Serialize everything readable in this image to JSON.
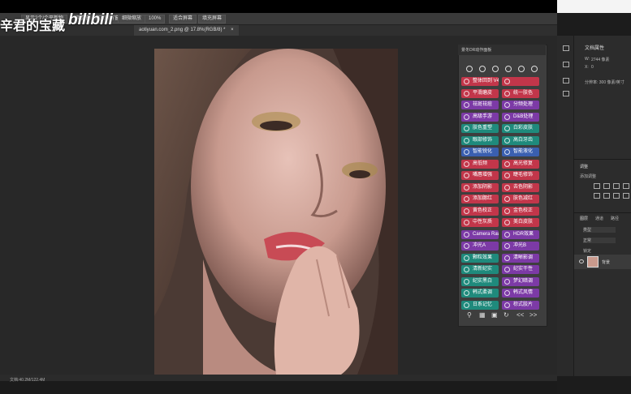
{
  "overlay": {
    "watermark": "辛君的宝藏",
    "bilibili_logo": "bilibili"
  },
  "options_bar": {
    "items": [
      "显示2个/个平新物",
      "调整窗口",
      "缩放所有窗",
      "细微缩放",
      "100%",
      "适合屏幕",
      "填充屏幕"
    ]
  },
  "document_tab": {
    "label": "aotiyuan.com_2.png @ 17.8%(RGB/8) *",
    "close": "×"
  },
  "plugin_panel": {
    "title": "景冬DR动作面板",
    "buttons": [
      {
        "label": "整体回到 V4.5",
        "color": "#c2364a"
      },
      {
        "label": "",
        "color": "#c2364a"
      },
      {
        "label": "平滑磨皮",
        "color": "#c2364a"
      },
      {
        "label": "统一肤色",
        "color": "#c2364a"
      },
      {
        "label": "祛斑祛痘",
        "color": "#7c3aa6"
      },
      {
        "label": "分频处理",
        "color": "#7c3aa6"
      },
      {
        "label": "高级手游",
        "color": "#7c3aa6"
      },
      {
        "label": "D&B处理",
        "color": "#7c3aa6"
      },
      {
        "label": "肤色重塑",
        "color": "#1f8a7c"
      },
      {
        "label": "白彩皮肤",
        "color": "#1f8a7c"
      },
      {
        "label": "眼部修饰",
        "color": "#1f8a7c"
      },
      {
        "label": "高白牙齿",
        "color": "#1f8a7c"
      },
      {
        "label": "智能锐化",
        "color": "#3a5fb0"
      },
      {
        "label": "智能液化",
        "color": "#3a5fb0"
      },
      {
        "label": "高低频",
        "color": "#c2364a"
      },
      {
        "label": "高光修复",
        "color": "#c2364a"
      },
      {
        "label": "嘴唇增强",
        "color": "#c2364a"
      },
      {
        "label": "睫毛修饰",
        "color": "#c2364a"
      },
      {
        "label": "添加阴影",
        "color": "#c2364a"
      },
      {
        "label": "去色阴影",
        "color": "#c2364a"
      },
      {
        "label": "添加腮红",
        "color": "#c2364a"
      },
      {
        "label": "肤色减红",
        "color": "#c2364a"
      },
      {
        "label": "黄色校正",
        "color": "#c2364a"
      },
      {
        "label": "金色校正",
        "color": "#c2364a"
      },
      {
        "label": "中性灰质",
        "color": "#c2364a"
      },
      {
        "label": "美白皮肤",
        "color": "#c2364a"
      },
      {
        "label": "Camera Raw",
        "color": "#7c3aa6"
      },
      {
        "label": "HDR效果",
        "color": "#7c3aa6"
      },
      {
        "label": "冲光A",
        "color": "#7c3aa6"
      },
      {
        "label": "冲光B",
        "color": "#7c3aa6"
      },
      {
        "label": "颗粒效果",
        "color": "#1f8a7c"
      },
      {
        "label": "清晰影调",
        "color": "#7c3aa6"
      },
      {
        "label": "清新纪实",
        "color": "#1f8a7c"
      },
      {
        "label": "纪实干性",
        "color": "#7c3aa6"
      },
      {
        "label": "纪实黑白",
        "color": "#1f8a7c"
      },
      {
        "label": "梦幻暗调",
        "color": "#7c3aa6"
      },
      {
        "label": "韩式柔调",
        "color": "#1f8a7c"
      },
      {
        "label": "韩式风情",
        "color": "#7c3aa6"
      },
      {
        "label": "日系记忆",
        "color": "#1f8a7c"
      },
      {
        "label": "棕式胶片",
        "color": "#7c3aa6"
      }
    ],
    "bottom_icons": [
      "search-icon",
      "grid-icon",
      "layers-icon",
      "refresh-icon",
      "back-icon",
      "forward-icon"
    ],
    "bottom_labels": [
      "<<",
      ">>"
    ]
  },
  "properties_panel": {
    "title": "文档属性",
    "w_label": "W:",
    "w_value": "2744 像素",
    "x_label": "X:",
    "x_value": "0",
    "res": "分辨率: 300 像素/英寸"
  },
  "adjustments_panel": {
    "tab": "调整",
    "hint": "添加调整"
  },
  "layers_panel": {
    "tabs": [
      "图层",
      "通道",
      "路径"
    ],
    "kind": "类型",
    "normal": "正常",
    "opacity": "不透明度",
    "lock": "锁定",
    "layer_name": "背景"
  },
  "status": {
    "zoom_info": "文档:40.2M/122.4M"
  },
  "colors": {
    "accent_red": "#c2364a",
    "accent_purple": "#7c3aa6",
    "accent_teal": "#1f8a7c"
  }
}
